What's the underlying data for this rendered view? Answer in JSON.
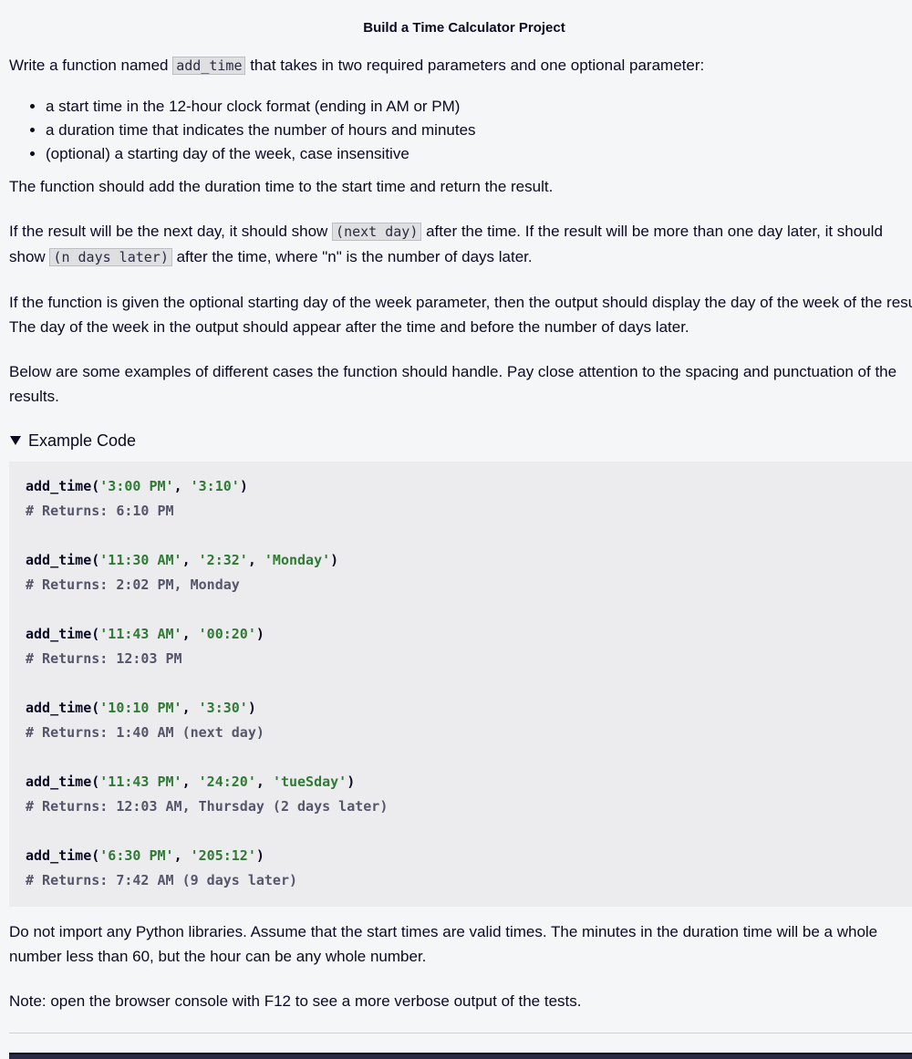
{
  "title": "Build a Time Calculator Project",
  "intro": {
    "before": "Write a function named ",
    "code": "add_time",
    "after": " that takes in two required parameters and one optional parameter:"
  },
  "params": [
    "a start time in the 12-hour clock format (ending in AM or PM)",
    "a duration time that indicates the number of hours and minutes",
    "(optional) a starting day of the week, case insensitive"
  ],
  "p_add": "The function should add the duration time to the start time and return the result.",
  "p_nextday": {
    "t1": "If the result will be the next day, it should show ",
    "c1": "(next day)",
    "t2": " after the time. If the result will be more than one day later, it should",
    "t3": "show ",
    "c2": "(n days later)",
    "t4": " after the time, where \"n\" is the number of days later."
  },
  "p_weekday": "If the function is given the optional starting day of the week parameter, then the output should display the day of the week of the result. The day of the week in the output should appear after the time and before the number of days later.",
  "p_examples": "Below are some examples of different cases the function should handle. Pay close attention to the spacing and punctuation of the results.",
  "summary": "Example Code",
  "examples": [
    {
      "fn": "add_time",
      "args": [
        "'3:00 PM'",
        "'3:10'"
      ],
      "comment": "# Returns: 6:10 PM"
    },
    {
      "fn": "add_time",
      "args": [
        "'11:30 AM'",
        "'2:32'",
        "'Monday'"
      ],
      "comment": "# Returns: 2:02 PM, Monday"
    },
    {
      "fn": "add_time",
      "args": [
        "'11:43 AM'",
        "'00:20'"
      ],
      "comment": "# Returns: 12:03 PM"
    },
    {
      "fn": "add_time",
      "args": [
        "'10:10 PM'",
        "'3:30'"
      ],
      "comment": "# Returns: 1:40 AM (next day)"
    },
    {
      "fn": "add_time",
      "args": [
        "'11:43 PM'",
        "'24:20'",
        "'tueSday'"
      ],
      "comment": "# Returns: 12:03 AM, Thursday (2 days later)"
    },
    {
      "fn": "add_time",
      "args": [
        "'6:30 PM'",
        "'205:12'"
      ],
      "comment": "# Returns: 7:42 AM (9 days later)"
    }
  ],
  "p_noimport": "Do not import any Python libraries. Assume that the start times are valid times. The minutes in the duration time will be a whole number less than 60, but the hour can be any whole number.",
  "p_note": "Note: open the browser console with F12 to see a more verbose output of the tests."
}
